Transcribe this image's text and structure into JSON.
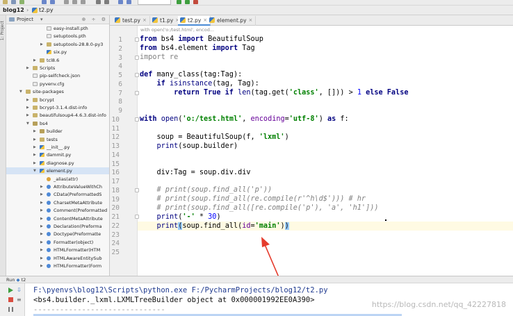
{
  "navbar": {
    "project_name": "blog12",
    "file_name": "t2.py"
  },
  "project_panel": {
    "header_label": "Project",
    "items": [
      {
        "label": "easy-install.pth",
        "kind": "file",
        "indent": 3,
        "arrow": ""
      },
      {
        "label": "setuptools.pth",
        "kind": "file",
        "indent": 3,
        "arrow": ""
      },
      {
        "label": "setuptools-28.8.0-py3",
        "kind": "folder",
        "indent": 3,
        "arrow": "▶"
      },
      {
        "label": "six.py",
        "kind": "py",
        "indent": 3,
        "arrow": ""
      },
      {
        "label": "tcl8.6",
        "kind": "folder",
        "indent": 2,
        "arrow": "▶"
      },
      {
        "label": "Scripts",
        "kind": "folder",
        "indent": 1,
        "arrow": "▶"
      },
      {
        "label": "pip-selfcheck.json",
        "kind": "file",
        "indent": 1,
        "arrow": ""
      },
      {
        "label": "pyvenv.cfg",
        "kind": "file",
        "indent": 1,
        "arrow": ""
      },
      {
        "label": "site-packages",
        "kind": "folder",
        "indent": 0,
        "arrow": "▼"
      },
      {
        "label": "bcrypt",
        "kind": "folder",
        "indent": 1,
        "arrow": "▶"
      },
      {
        "label": "bcrypt-3.1.4.dist-info",
        "kind": "folder",
        "indent": 1,
        "arrow": "▶"
      },
      {
        "label": "beautifulsoup4-4.6.3.dist-info",
        "kind": "folder",
        "indent": 1,
        "arrow": "▶"
      },
      {
        "label": "bs4",
        "kind": "pkg",
        "indent": 1,
        "arrow": "▼"
      },
      {
        "label": "builder",
        "kind": "pkg",
        "indent": 2,
        "arrow": "▶"
      },
      {
        "label": "tests",
        "kind": "folder",
        "indent": 2,
        "arrow": "▶"
      },
      {
        "label": "__init__.py",
        "kind": "py",
        "indent": 2,
        "arrow": "▶"
      },
      {
        "label": "dammit.py",
        "kind": "py",
        "indent": 2,
        "arrow": "▶"
      },
      {
        "label": "diagnose.py",
        "kind": "py",
        "indent": 2,
        "arrow": "▶"
      },
      {
        "label": "element.py",
        "kind": "py",
        "indent": 2,
        "arrow": "▼"
      },
      {
        "label": "_alias(attr)",
        "kind": "fn",
        "indent": 3,
        "arrow": ""
      },
      {
        "label": "AttributeValueWithCh",
        "kind": "cls",
        "indent": 3,
        "arrow": "▶"
      },
      {
        "label": "CData(PreformattedS",
        "kind": "cls",
        "indent": 3,
        "arrow": "▶"
      },
      {
        "label": "CharsetMetaAttribute",
        "kind": "cls",
        "indent": 3,
        "arrow": "▶"
      },
      {
        "label": "Comment(Preformatted",
        "kind": "cls",
        "indent": 3,
        "arrow": "▶"
      },
      {
        "label": "ContentMetaAttribute",
        "kind": "cls",
        "indent": 3,
        "arrow": "▶"
      },
      {
        "label": "Declaration(Preforma",
        "kind": "cls",
        "indent": 3,
        "arrow": "▶"
      },
      {
        "label": "Doctype(Preformatte",
        "kind": "cls",
        "indent": 3,
        "arrow": "▶"
      },
      {
        "label": "Formatter(object)",
        "kind": "cls",
        "indent": 3,
        "arrow": "▶"
      },
      {
        "label": "HTMLFormatter(HTM",
        "kind": "cls",
        "indent": 3,
        "arrow": "▶"
      },
      {
        "label": "HTMLAwareEntitySub",
        "kind": "cls",
        "indent": 3,
        "arrow": "▶"
      },
      {
        "label": "HTMLFormatter(Form",
        "kind": "cls",
        "indent": 3,
        "arrow": "▶"
      }
    ]
  },
  "tabs": [
    {
      "label": "test.py",
      "active": false
    },
    {
      "label": "t1.py",
      "active": false
    },
    {
      "label": "t2.py",
      "active": true
    },
    {
      "label": "element.py",
      "active": false
    }
  ],
  "editor": {
    "context_hint": "with open('o:/test.html', encod...",
    "line_numbers": [
      "1",
      "2",
      "3",
      "4",
      "5",
      "6",
      "7",
      "8",
      "9",
      "10",
      "11",
      "12",
      "13",
      "14",
      "15",
      "16",
      "17",
      "18",
      "19",
      "20",
      "21",
      "22",
      "23",
      "24",
      "25"
    ],
    "lines": {
      "l1": "from bs4 import BeautifulSoup",
      "l2": "from bs4.element import Tag",
      "l3": "import re",
      "l5": "def many_class(tag:Tag):",
      "l6": "    if isinstance(tag, Tag):",
      "l7": "        return True if len(tag.get('class', [])) > 1 else False",
      "l10": "with open('o:/test.html', encoding='utf-8') as f:",
      "l12": "    soup = BeautifulSoup(f, 'lxml')",
      "l13": "    print(soup.builder)",
      "l16": "    div:Tag = soup.div.div",
      "l18": "    # print(soup.find_all('p'))",
      "l19": "    # print(soup.find_all(re.compile(r'^h\\d$'))) # hr",
      "l20": "    # print(soup.find_all([re.compile('p'), 'a', 'h1']))",
      "l21": "    print('-' * 30)",
      "l22": "    print(soup.find_all(id='main'))"
    }
  },
  "run_panel": {
    "title": "Run",
    "tab_label": "t2",
    "lines": [
      "F:\\pyenvs\\blog12\\Scripts\\python.exe F:/PycharmProjects/blog12/t2.py",
      "<bs4.builder._lxml.LXMLTreeBuilder object at 0x000001992EE0A390>",
      "------------------------------"
    ],
    "watermark": "https://blog.csdn.net/qq_42227818"
  },
  "colors": {
    "keyword": "#000080",
    "string": "#008000",
    "comment": "#808080",
    "number": "#0000ff",
    "arrow": "#e53b2c",
    "tab_accent": "#4a8bd6"
  }
}
